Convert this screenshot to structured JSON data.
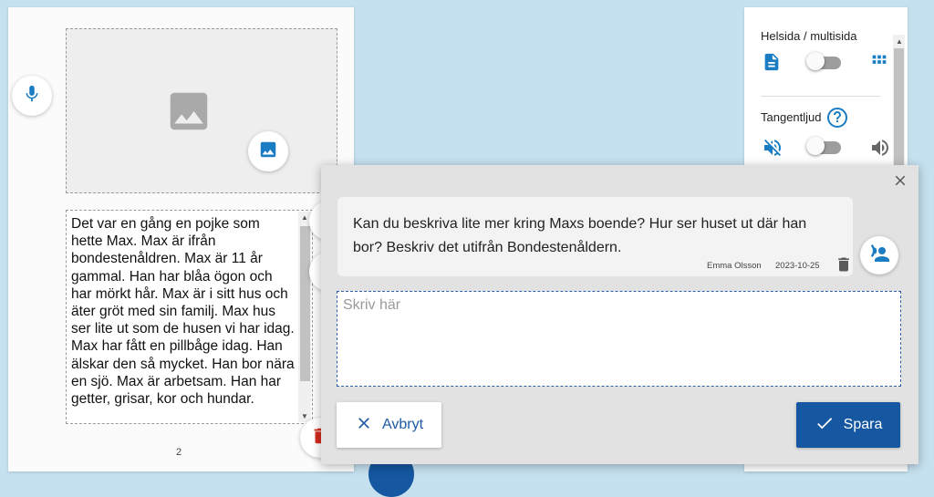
{
  "page": {
    "story_text": "Det var en gång en pojke som hette Max. Max är ifrån bondestenåldren. Max är 11 år gammal. Han har blåa ögon och har mörkt hår. Max är i sitt hus och äter gröt med sin familj. Max hus ser lite ut som de husen vi har idag. Max har fått en pillbåge idag. Han älskar den så mycket. Han bor nära en sjö. Max är arbetsam. Han har getter, grisar, kor och hundar.",
    "page_number": "2",
    "icons": {
      "record": "microphone-icon",
      "image_placeholder": "image-icon",
      "add_image": "image-icon",
      "delete": "trash-icon"
    }
  },
  "settings": {
    "page_mode_label": "Helsida / multisida",
    "page_mode_on": false,
    "key_sound_label": "Tangentljud",
    "key_sound_on": false,
    "icons": {
      "single_page": "document-icon",
      "multi_page": "grid-icon",
      "help": "help-circle-icon",
      "sound_off": "volume-off-icon",
      "sound_on": "volume-up-icon"
    }
  },
  "dialog": {
    "question": "Kan du beskriva lite mer kring Maxs boende? Hur ser huset ut där han bor? Beskriv det utifrån Bondestenåldern.",
    "author": "Emma Olsson",
    "date": "2023-10-25",
    "answer_placeholder": "Skriv här",
    "answer_value": "",
    "cancel_label": "Avbryt",
    "save_label": "Spara"
  },
  "colors": {
    "accent": "#1a7dc4",
    "primary_button": "#1557a0",
    "background": "#c5e0ef",
    "delete_red": "#d22b1f"
  }
}
